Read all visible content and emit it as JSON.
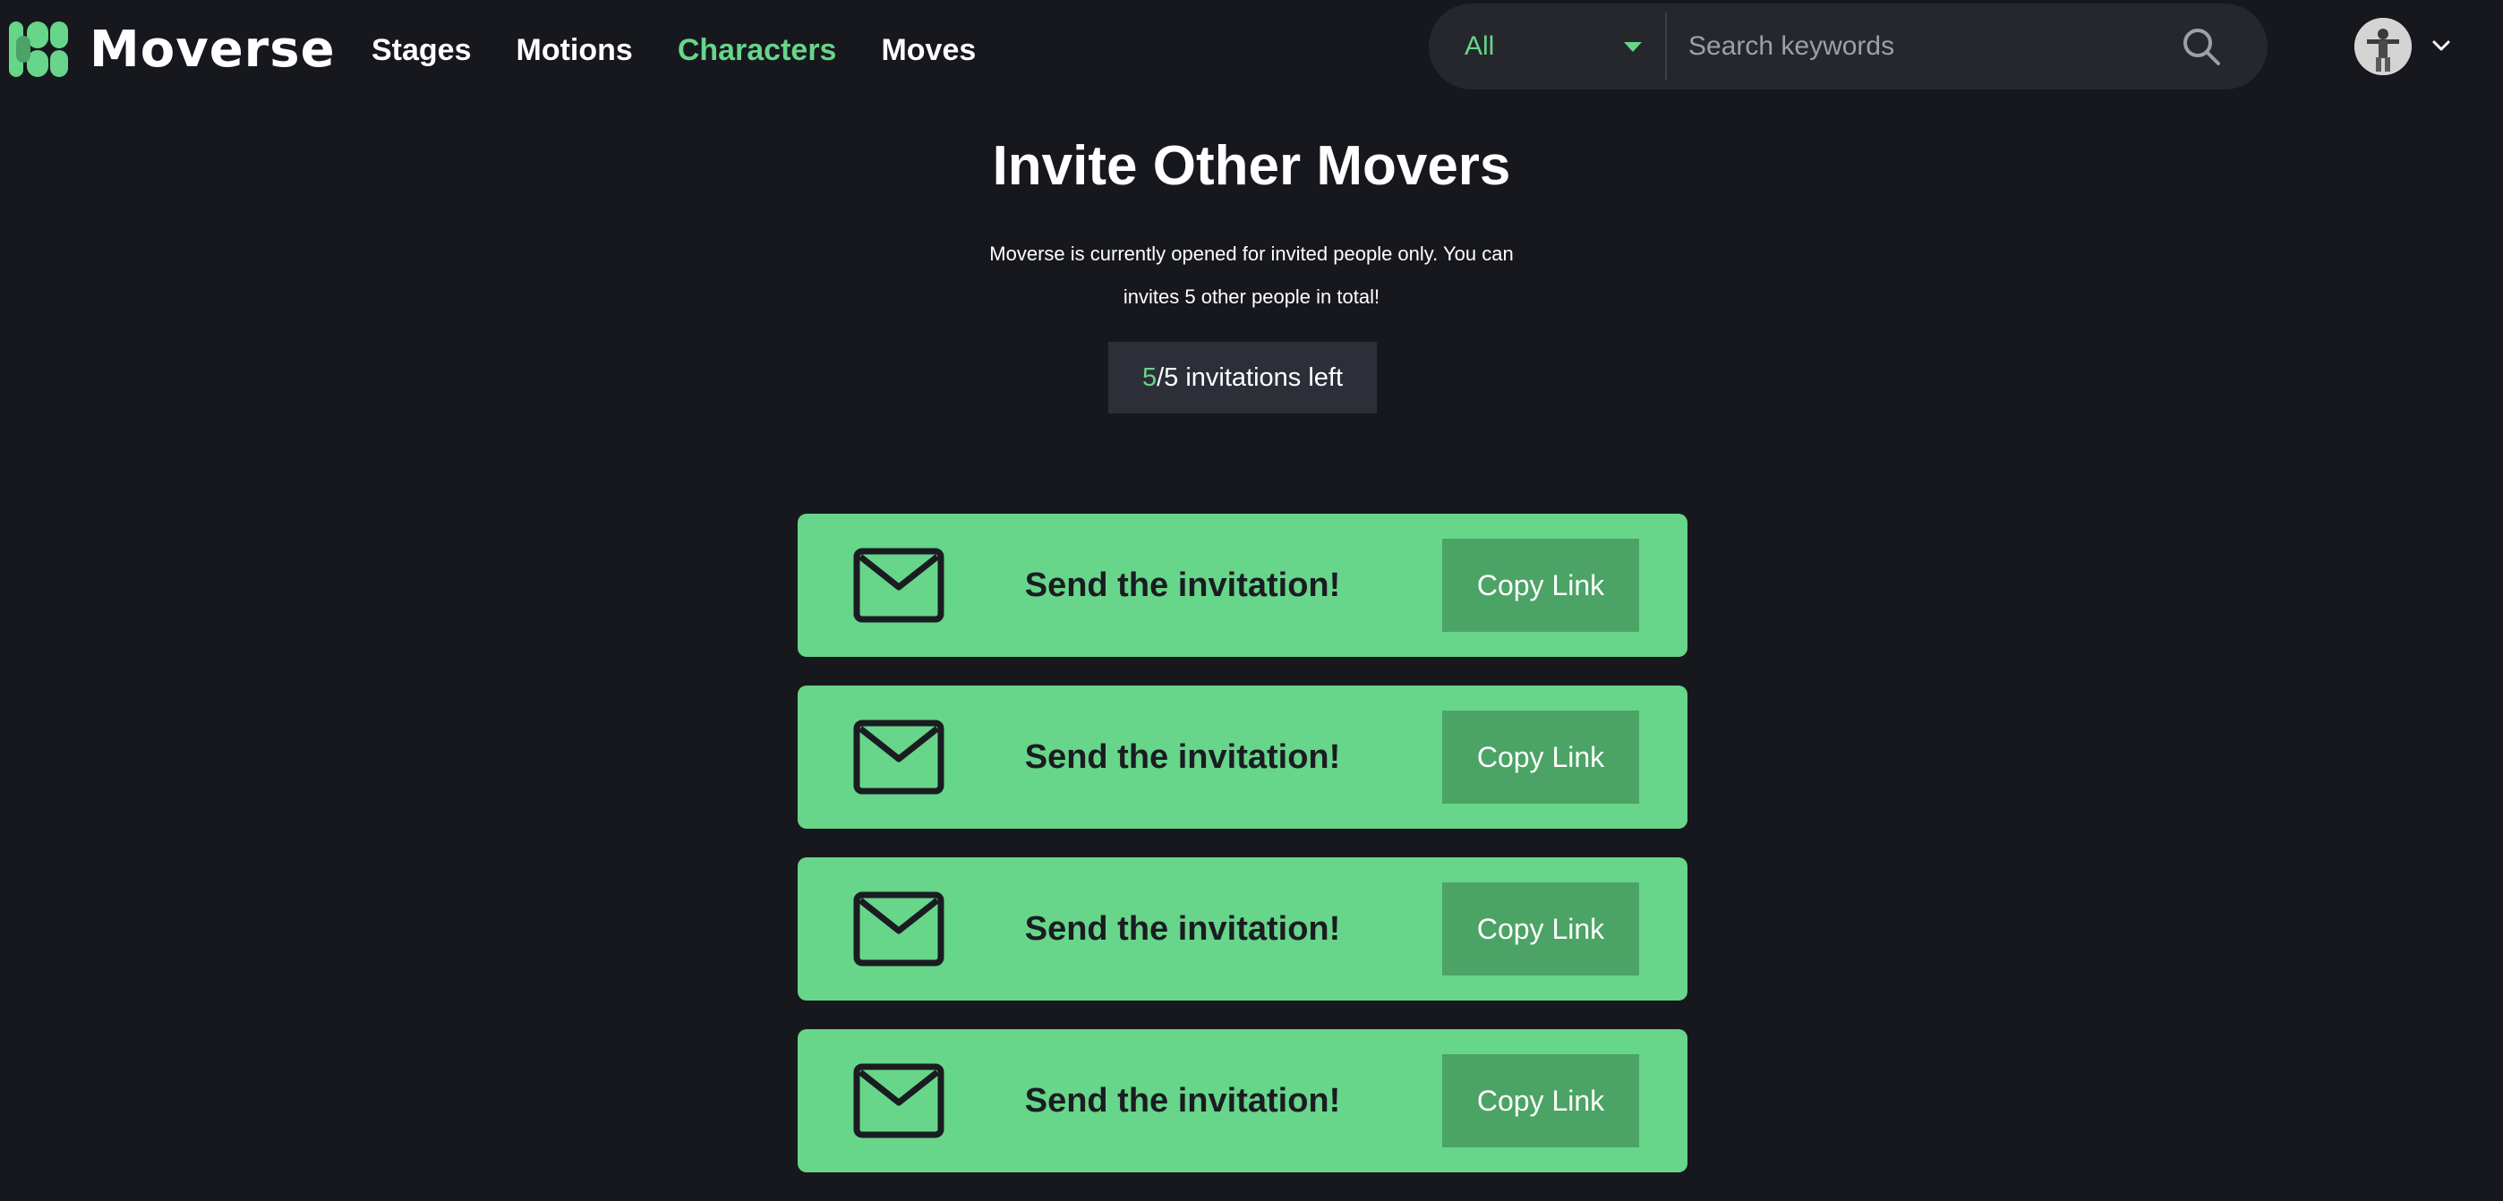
{
  "brand": {
    "name": "Moverse",
    "accent": "#67d58a"
  },
  "nav": {
    "items": [
      {
        "label": "Stages",
        "active": false
      },
      {
        "label": "Motions",
        "active": false
      },
      {
        "label": "Characters",
        "active": true
      },
      {
        "label": "Moves",
        "active": false
      }
    ]
  },
  "search": {
    "filter_selected": "All",
    "placeholder": "Search keywords",
    "icon": "search-icon"
  },
  "user": {
    "avatar_icon": "avatar",
    "menu_icon": "chevron-down-icon"
  },
  "main": {
    "title": "Invite Other Movers",
    "description": "Moverse is currently opened for invited people only. You can invites 5 other people in total!",
    "invitations": {
      "left": "5",
      "total_text": "/5 invitations left"
    },
    "cards": [
      {
        "text": "Send the invitation!",
        "button": "Copy Link",
        "icon": "mail-icon"
      },
      {
        "text": "Send the invitation!",
        "button": "Copy Link",
        "icon": "mail-icon"
      },
      {
        "text": "Send the invitation!",
        "button": "Copy Link",
        "icon": "mail-icon"
      },
      {
        "text": "Send the invitation!",
        "button": "Copy Link",
        "icon": "mail-icon"
      }
    ]
  }
}
